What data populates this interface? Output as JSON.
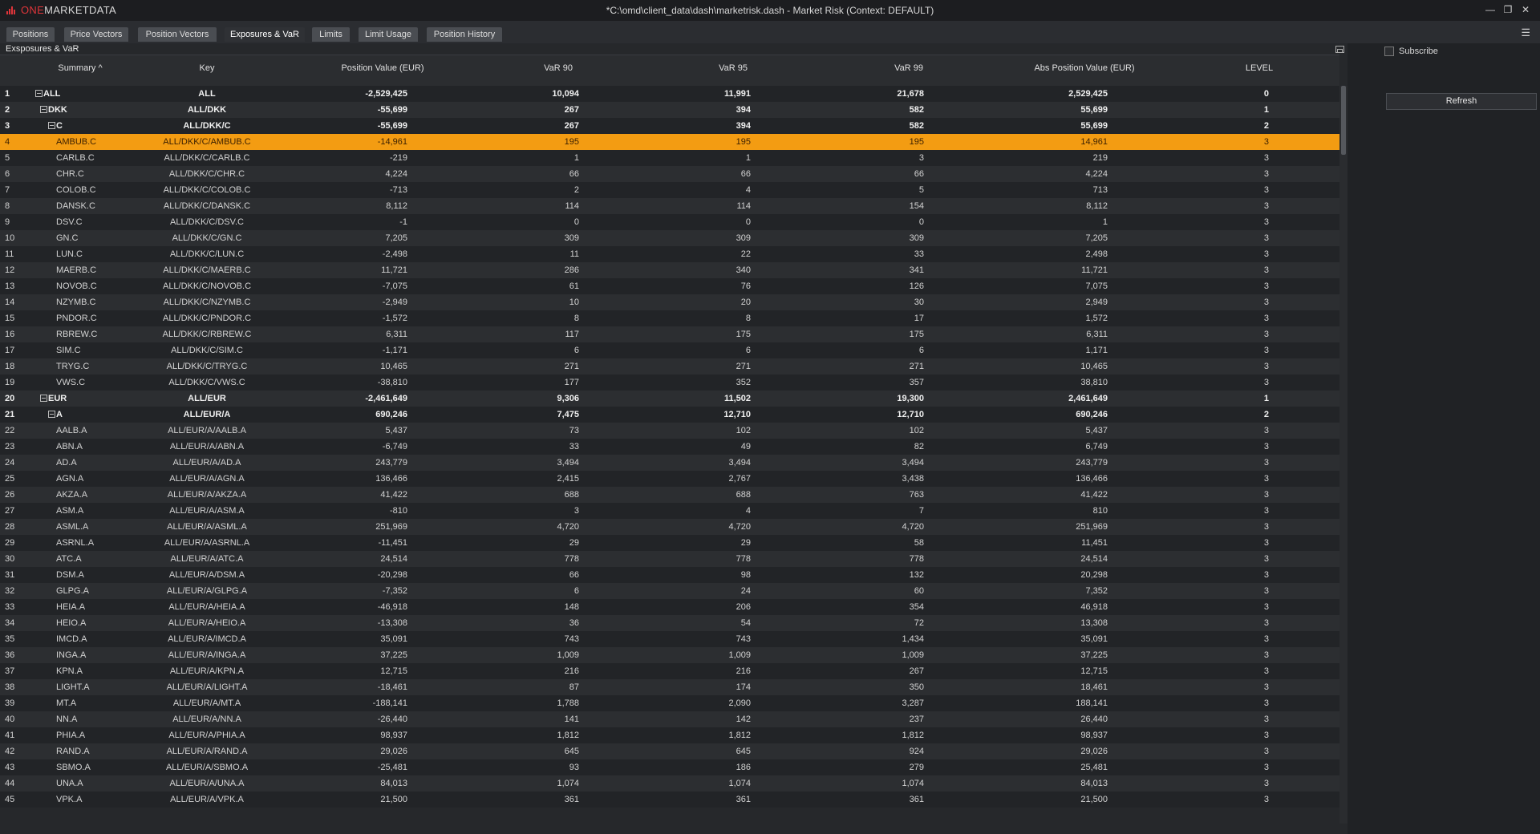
{
  "app": {
    "logo_prefix": "ONE",
    "logo_suffix": "MARKETDATA",
    "window_title": "*C:\\omd\\client_data\\dash\\marketrisk.dash - Market Risk (Context: DEFAULT)"
  },
  "tabs": [
    "Positions",
    "Price Vectors",
    "Position Vectors",
    "Exposures & VaR",
    "Limits",
    "Limit Usage",
    "Position History"
  ],
  "active_tab": "Exposures & VaR",
  "panel": {
    "title": "Exsposures & VaR",
    "columns": [
      "Summary",
      "Key",
      "Position Value (EUR)",
      "VaR 90",
      "VaR 95",
      "VaR 99",
      "Abs Position Value (EUR)",
      "LEVEL"
    ],
    "sort_indicator": "^"
  },
  "side": {
    "subscribe_label": "Subscribe",
    "refresh_label": "Refresh"
  },
  "rows": [
    {
      "n": "1",
      "summary": "ALL",
      "key": "ALL",
      "pv": "-2,529,425",
      "v90": "10,094",
      "v95": "11,991",
      "v99": "21,678",
      "abs": "2,529,425",
      "lvl": "0"
    },
    {
      "n": "2",
      "summary": "DKK",
      "key": "ALL/DKK",
      "pv": "-55,699",
      "v90": "267",
      "v95": "394",
      "v99": "582",
      "abs": "55,699",
      "lvl": "1"
    },
    {
      "n": "3",
      "summary": "C",
      "key": "ALL/DKK/C",
      "pv": "-55,699",
      "v90": "267",
      "v95": "394",
      "v99": "582",
      "abs": "55,699",
      "lvl": "2"
    },
    {
      "n": "4",
      "summary": "AMBUB.C",
      "key": "ALL/DKK/C/AMBUB.C",
      "pv": "-14,961",
      "v90": "195",
      "v95": "195",
      "v99": "195",
      "abs": "14,961",
      "lvl": "3"
    },
    {
      "n": "5",
      "summary": "CARLB.C",
      "key": "ALL/DKK/C/CARLB.C",
      "pv": "-219",
      "v90": "1",
      "v95": "1",
      "v99": "3",
      "abs": "219",
      "lvl": "3"
    },
    {
      "n": "6",
      "summary": "CHR.C",
      "key": "ALL/DKK/C/CHR.C",
      "pv": "4,224",
      "v90": "66",
      "v95": "66",
      "v99": "66",
      "abs": "4,224",
      "lvl": "3"
    },
    {
      "n": "7",
      "summary": "COLOB.C",
      "key": "ALL/DKK/C/COLOB.C",
      "pv": "-713",
      "v90": "2",
      "v95": "4",
      "v99": "5",
      "abs": "713",
      "lvl": "3"
    },
    {
      "n": "8",
      "summary": "DANSK.C",
      "key": "ALL/DKK/C/DANSK.C",
      "pv": "8,112",
      "v90": "114",
      "v95": "114",
      "v99": "154",
      "abs": "8,112",
      "lvl": "3"
    },
    {
      "n": "9",
      "summary": "DSV.C",
      "key": "ALL/DKK/C/DSV.C",
      "pv": "-1",
      "v90": "0",
      "v95": "0",
      "v99": "0",
      "abs": "1",
      "lvl": "3"
    },
    {
      "n": "10",
      "summary": "GN.C",
      "key": "ALL/DKK/C/GN.C",
      "pv": "7,205",
      "v90": "309",
      "v95": "309",
      "v99": "309",
      "abs": "7,205",
      "lvl": "3"
    },
    {
      "n": "11",
      "summary": "LUN.C",
      "key": "ALL/DKK/C/LUN.C",
      "pv": "-2,498",
      "v90": "11",
      "v95": "22",
      "v99": "33",
      "abs": "2,498",
      "lvl": "3"
    },
    {
      "n": "12",
      "summary": "MAERB.C",
      "key": "ALL/DKK/C/MAERB.C",
      "pv": "11,721",
      "v90": "286",
      "v95": "340",
      "v99": "341",
      "abs": "11,721",
      "lvl": "3"
    },
    {
      "n": "13",
      "summary": "NOVOB.C",
      "key": "ALL/DKK/C/NOVOB.C",
      "pv": "-7,075",
      "v90": "61",
      "v95": "76",
      "v99": "126",
      "abs": "7,075",
      "lvl": "3"
    },
    {
      "n": "14",
      "summary": "NZYMB.C",
      "key": "ALL/DKK/C/NZYMB.C",
      "pv": "-2,949",
      "v90": "10",
      "v95": "20",
      "v99": "30",
      "abs": "2,949",
      "lvl": "3"
    },
    {
      "n": "15",
      "summary": "PNDOR.C",
      "key": "ALL/DKK/C/PNDOR.C",
      "pv": "-1,572",
      "v90": "8",
      "v95": "8",
      "v99": "17",
      "abs": "1,572",
      "lvl": "3"
    },
    {
      "n": "16",
      "summary": "RBREW.C",
      "key": "ALL/DKK/C/RBREW.C",
      "pv": "6,311",
      "v90": "117",
      "v95": "175",
      "v99": "175",
      "abs": "6,311",
      "lvl": "3"
    },
    {
      "n": "17",
      "summary": "SIM.C",
      "key": "ALL/DKK/C/SIM.C",
      "pv": "-1,171",
      "v90": "6",
      "v95": "6",
      "v99": "6",
      "abs": "1,171",
      "lvl": "3"
    },
    {
      "n": "18",
      "summary": "TRYG.C",
      "key": "ALL/DKK/C/TRYG.C",
      "pv": "10,465",
      "v90": "271",
      "v95": "271",
      "v99": "271",
      "abs": "10,465",
      "lvl": "3"
    },
    {
      "n": "19",
      "summary": "VWS.C",
      "key": "ALL/DKK/C/VWS.C",
      "pv": "-38,810",
      "v90": "177",
      "v95": "352",
      "v99": "357",
      "abs": "38,810",
      "lvl": "3"
    },
    {
      "n": "20",
      "summary": "EUR",
      "key": "ALL/EUR",
      "pv": "-2,461,649",
      "v90": "9,306",
      "v95": "11,502",
      "v99": "19,300",
      "abs": "2,461,649",
      "lvl": "1"
    },
    {
      "n": "21",
      "summary": "A",
      "key": "ALL/EUR/A",
      "pv": "690,246",
      "v90": "7,475",
      "v95": "12,710",
      "v99": "12,710",
      "abs": "690,246",
      "lvl": "2"
    },
    {
      "n": "22",
      "summary": "AALB.A",
      "key": "ALL/EUR/A/AALB.A",
      "pv": "5,437",
      "v90": "73",
      "v95": "102",
      "v99": "102",
      "abs": "5,437",
      "lvl": "3"
    },
    {
      "n": "23",
      "summary": "ABN.A",
      "key": "ALL/EUR/A/ABN.A",
      "pv": "-6,749",
      "v90": "33",
      "v95": "49",
      "v99": "82",
      "abs": "6,749",
      "lvl": "3"
    },
    {
      "n": "24",
      "summary": "AD.A",
      "key": "ALL/EUR/A/AD.A",
      "pv": "243,779",
      "v90": "3,494",
      "v95": "3,494",
      "v99": "3,494",
      "abs": "243,779",
      "lvl": "3"
    },
    {
      "n": "25",
      "summary": "AGN.A",
      "key": "ALL/EUR/A/AGN.A",
      "pv": "136,466",
      "v90": "2,415",
      "v95": "2,767",
      "v99": "3,438",
      "abs": "136,466",
      "lvl": "3"
    },
    {
      "n": "26",
      "summary": "AKZA.A",
      "key": "ALL/EUR/A/AKZA.A",
      "pv": "41,422",
      "v90": "688",
      "v95": "688",
      "v99": "763",
      "abs": "41,422",
      "lvl": "3"
    },
    {
      "n": "27",
      "summary": "ASM.A",
      "key": "ALL/EUR/A/ASM.A",
      "pv": "-810",
      "v90": "3",
      "v95": "4",
      "v99": "7",
      "abs": "810",
      "lvl": "3"
    },
    {
      "n": "28",
      "summary": "ASML.A",
      "key": "ALL/EUR/A/ASML.A",
      "pv": "251,969",
      "v90": "4,720",
      "v95": "4,720",
      "v99": "4,720",
      "abs": "251,969",
      "lvl": "3"
    },
    {
      "n": "29",
      "summary": "ASRNL.A",
      "key": "ALL/EUR/A/ASRNL.A",
      "pv": "-11,451",
      "v90": "29",
      "v95": "29",
      "v99": "58",
      "abs": "11,451",
      "lvl": "3"
    },
    {
      "n": "30",
      "summary": "ATC.A",
      "key": "ALL/EUR/A/ATC.A",
      "pv": "24,514",
      "v90": "778",
      "v95": "778",
      "v99": "778",
      "abs": "24,514",
      "lvl": "3"
    },
    {
      "n": "31",
      "summary": "DSM.A",
      "key": "ALL/EUR/A/DSM.A",
      "pv": "-20,298",
      "v90": "66",
      "v95": "98",
      "v99": "132",
      "abs": "20,298",
      "lvl": "3"
    },
    {
      "n": "32",
      "summary": "GLPG.A",
      "key": "ALL/EUR/A/GLPG.A",
      "pv": "-7,352",
      "v90": "6",
      "v95": "24",
      "v99": "60",
      "abs": "7,352",
      "lvl": "3"
    },
    {
      "n": "33",
      "summary": "HEIA.A",
      "key": "ALL/EUR/A/HEIA.A",
      "pv": "-46,918",
      "v90": "148",
      "v95": "206",
      "v99": "354",
      "abs": "46,918",
      "lvl": "3"
    },
    {
      "n": "34",
      "summary": "HEIO.A",
      "key": "ALL/EUR/A/HEIO.A",
      "pv": "-13,308",
      "v90": "36",
      "v95": "54",
      "v99": "72",
      "abs": "13,308",
      "lvl": "3"
    },
    {
      "n": "35",
      "summary": "IMCD.A",
      "key": "ALL/EUR/A/IMCD.A",
      "pv": "35,091",
      "v90": "743",
      "v95": "743",
      "v99": "1,434",
      "abs": "35,091",
      "lvl": "3"
    },
    {
      "n": "36",
      "summary": "INGA.A",
      "key": "ALL/EUR/A/INGA.A",
      "pv": "37,225",
      "v90": "1,009",
      "v95": "1,009",
      "v99": "1,009",
      "abs": "37,225",
      "lvl": "3"
    },
    {
      "n": "37",
      "summary": "KPN.A",
      "key": "ALL/EUR/A/KPN.A",
      "pv": "12,715",
      "v90": "216",
      "v95": "216",
      "v99": "267",
      "abs": "12,715",
      "lvl": "3"
    },
    {
      "n": "38",
      "summary": "LIGHT.A",
      "key": "ALL/EUR/A/LIGHT.A",
      "pv": "-18,461",
      "v90": "87",
      "v95": "174",
      "v99": "350",
      "abs": "18,461",
      "lvl": "3"
    },
    {
      "n": "39",
      "summary": "MT.A",
      "key": "ALL/EUR/A/MT.A",
      "pv": "-188,141",
      "v90": "1,788",
      "v95": "2,090",
      "v99": "3,287",
      "abs": "188,141",
      "lvl": "3"
    },
    {
      "n": "40",
      "summary": "NN.A",
      "key": "ALL/EUR/A/NN.A",
      "pv": "-26,440",
      "v90": "141",
      "v95": "142",
      "v99": "237",
      "abs": "26,440",
      "lvl": "3"
    },
    {
      "n": "41",
      "summary": "PHIA.A",
      "key": "ALL/EUR/A/PHIA.A",
      "pv": "98,937",
      "v90": "1,812",
      "v95": "1,812",
      "v99": "1,812",
      "abs": "98,937",
      "lvl": "3"
    },
    {
      "n": "42",
      "summary": "RAND.A",
      "key": "ALL/EUR/A/RAND.A",
      "pv": "29,026",
      "v90": "645",
      "v95": "645",
      "v99": "924",
      "abs": "29,026",
      "lvl": "3"
    },
    {
      "n": "43",
      "summary": "SBMO.A",
      "key": "ALL/EUR/A/SBMO.A",
      "pv": "-25,481",
      "v90": "93",
      "v95": "186",
      "v99": "279",
      "abs": "25,481",
      "lvl": "3"
    },
    {
      "n": "44",
      "summary": "UNA.A",
      "key": "ALL/EUR/A/UNA.A",
      "pv": "84,013",
      "v90": "1,074",
      "v95": "1,074",
      "v99": "1,074",
      "abs": "84,013",
      "lvl": "3"
    },
    {
      "n": "45",
      "summary": "VPK.A",
      "key": "ALL/EUR/A/VPK.A",
      "pv": "21,500",
      "v90": "361",
      "v95": "361",
      "v99": "361",
      "abs": "21,500",
      "lvl": "3"
    }
  ],
  "selected_row": "4",
  "colors": {
    "selection": "#f39c12",
    "logo_red": "#e0353a",
    "background": "#202225"
  }
}
